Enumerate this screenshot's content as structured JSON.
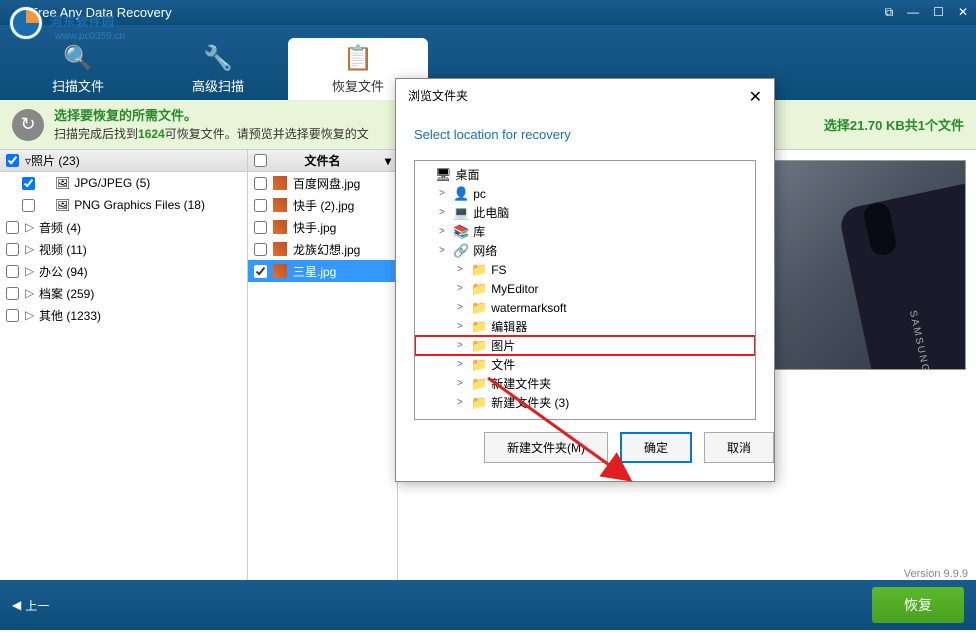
{
  "app": {
    "title": "Free Any Data Recovery"
  },
  "watermark": {
    "text": "河东软件园",
    "url": "www.pc0359.cn"
  },
  "tabs": [
    {
      "label": "扫描文件",
      "icon": "🔍"
    },
    {
      "label": "高级扫描",
      "icon": "🔧"
    },
    {
      "label": "恢复文件",
      "icon": "📋"
    }
  ],
  "info": {
    "title": "选择要恢复的所需文件。",
    "sub_prefix": "扫描完成后找到",
    "count": "1624",
    "sub_suffix": "可恢复文件。请预览并选择要恢复的文",
    "right": "选择21.70 KB共1个文件"
  },
  "tree_header": "照片 (23)",
  "tree": [
    {
      "label": "JPG/JPEG (5)",
      "sub": true,
      "icon": "🖼",
      "checked": true
    },
    {
      "label": "PNG Graphics Files (18)",
      "sub": true,
      "icon": "🖼"
    },
    {
      "label": "音频 (4)",
      "expand": "▷"
    },
    {
      "label": "视频 (11)",
      "expand": "▷"
    },
    {
      "label": "办公 (94)",
      "expand": "▷"
    },
    {
      "label": "档案 (259)",
      "expand": "▷"
    },
    {
      "label": "其他 (1233)",
      "expand": "▷"
    }
  ],
  "file_header": "文件名",
  "files": [
    {
      "name": "百度网盘.jpg"
    },
    {
      "name": "快手 (2).jpg"
    },
    {
      "name": "快手.jpg"
    },
    {
      "name": "龙族幻想.jpg"
    },
    {
      "name": "三星.jpg",
      "selected": true,
      "checked": true
    }
  ],
  "dialog": {
    "title": "浏览文件夹",
    "instruction": "Select location for recovery",
    "items": [
      {
        "label": "桌面",
        "icon": "🖥",
        "color": "#3070d0",
        "depth": 0
      },
      {
        "label": "pc",
        "icon": "👤",
        "depth": 1,
        "expand": ">"
      },
      {
        "label": "此电脑",
        "icon": "💻",
        "depth": 1,
        "expand": ">"
      },
      {
        "label": "库",
        "icon": "📚",
        "depth": 1,
        "expand": ">"
      },
      {
        "label": "网络",
        "icon": "🔗",
        "depth": 1,
        "expand": ">"
      },
      {
        "label": "FS",
        "icon": "📁",
        "depth": 2,
        "expand": ">"
      },
      {
        "label": "MyEditor",
        "icon": "📁",
        "depth": 2,
        "expand": ">"
      },
      {
        "label": "watermarksoft",
        "icon": "📁",
        "depth": 2,
        "expand": ">"
      },
      {
        "label": "编辑器",
        "icon": "📁",
        "depth": 2,
        "expand": ">"
      },
      {
        "label": "图片",
        "icon": "📁",
        "depth": 2,
        "expand": ">",
        "highlighted": true
      },
      {
        "label": "文件",
        "icon": "📁",
        "depth": 2,
        "expand": ">"
      },
      {
        "label": "新建文件夹",
        "icon": "📁",
        "depth": 2,
        "expand": ">"
      },
      {
        "label": "新建文件夹 (3)",
        "icon": "📁",
        "depth": 2,
        "expand": ">"
      }
    ],
    "new_folder": "新建文件夹(M)",
    "ok": "确定",
    "cancel": "取消"
  },
  "bottom": {
    "prev": "上一",
    "recover": "恢复"
  },
  "version": "Version 9.9.9"
}
